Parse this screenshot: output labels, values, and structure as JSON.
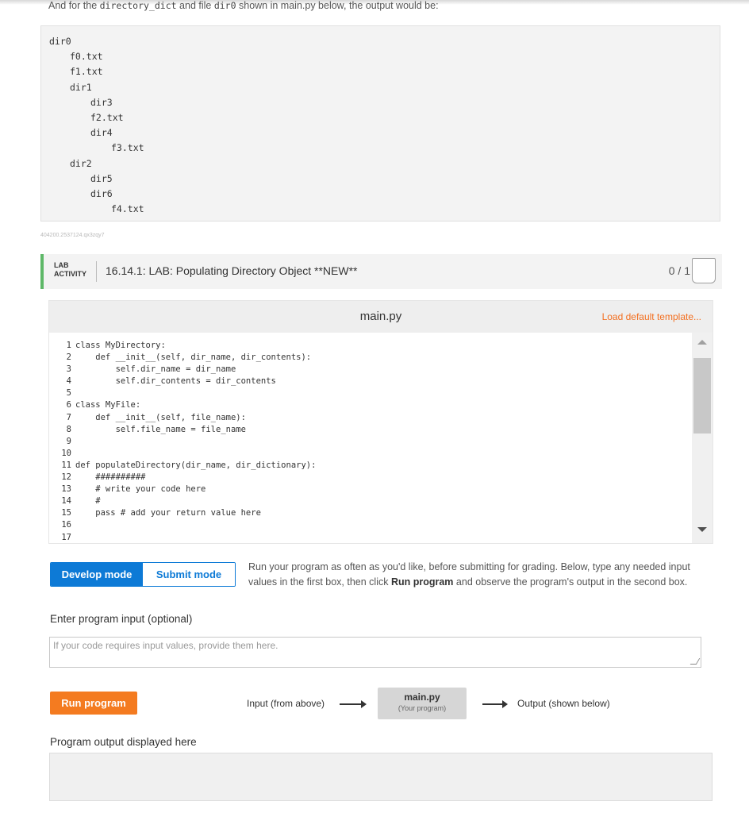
{
  "intro": {
    "prefix": "And for the ",
    "code1": "directory_dict",
    "middle": " and file ",
    "code2": "dir0",
    "suffix": " shown in main.py below, the output would be:"
  },
  "tree_lines": [
    {
      "depth": 0,
      "text": "dir0"
    },
    {
      "depth": 1,
      "text": "f0.txt"
    },
    {
      "depth": 1,
      "text": "f1.txt"
    },
    {
      "depth": 1,
      "text": "dir1"
    },
    {
      "depth": 2,
      "text": "dir3"
    },
    {
      "depth": 2,
      "text": "f2.txt"
    },
    {
      "depth": 2,
      "text": "dir4"
    },
    {
      "depth": 3,
      "text": "f3.txt"
    },
    {
      "depth": 1,
      "text": "dir2"
    },
    {
      "depth": 2,
      "text": "dir5"
    },
    {
      "depth": 2,
      "text": "dir6"
    },
    {
      "depth": 3,
      "text": "f4.txt"
    }
  ],
  "reference_id": "404200.2537124.qx3zqy7",
  "lab": {
    "tag_line1": "LAB",
    "tag_line2": "ACTIVITY",
    "title": "16.14.1: LAB: Populating Directory Object **NEW**",
    "score": "0 / 1"
  },
  "editor": {
    "filename": "main.py",
    "load_template": "Load default template..."
  },
  "code_lines": [
    "class MyDirectory:",
    "    def __init__(self, dir_name, dir_contents):",
    "        self.dir_name = dir_name",
    "        self.dir_contents = dir_contents",
    "",
    "class MyFile:",
    "    def __init__(self, file_name):",
    "        self.file_name = file_name",
    "",
    "",
    "def populateDirectory(dir_name, dir_dictionary):",
    "    ##########",
    "    # write your code here",
    "    #",
    "    pass # add your return value here",
    "",
    ""
  ],
  "modes": {
    "develop": "Develop mode",
    "submit": "Submit mode"
  },
  "description": {
    "part1": "Run your program as often as you'd like, before submitting for grading. Below, type any needed input values in the first box, then click ",
    "bold": "Run program",
    "part2": " and observe the program's output in the second box."
  },
  "input": {
    "label": "Enter program input (optional)",
    "placeholder": "If your code requires input values, provide them here."
  },
  "run": {
    "button": "Run program",
    "flow_in": "Input (from above)",
    "chip_title": "main.py",
    "chip_sub": "(Your program)",
    "flow_out": "Output (shown below)"
  },
  "output": {
    "label": "Program output displayed here",
    "value": ""
  },
  "colors": {
    "accent_blue": "#0d7ad6",
    "run_orange": "#f47b20",
    "lab_green": "#5eb868",
    "link_orange": "#f37021"
  }
}
